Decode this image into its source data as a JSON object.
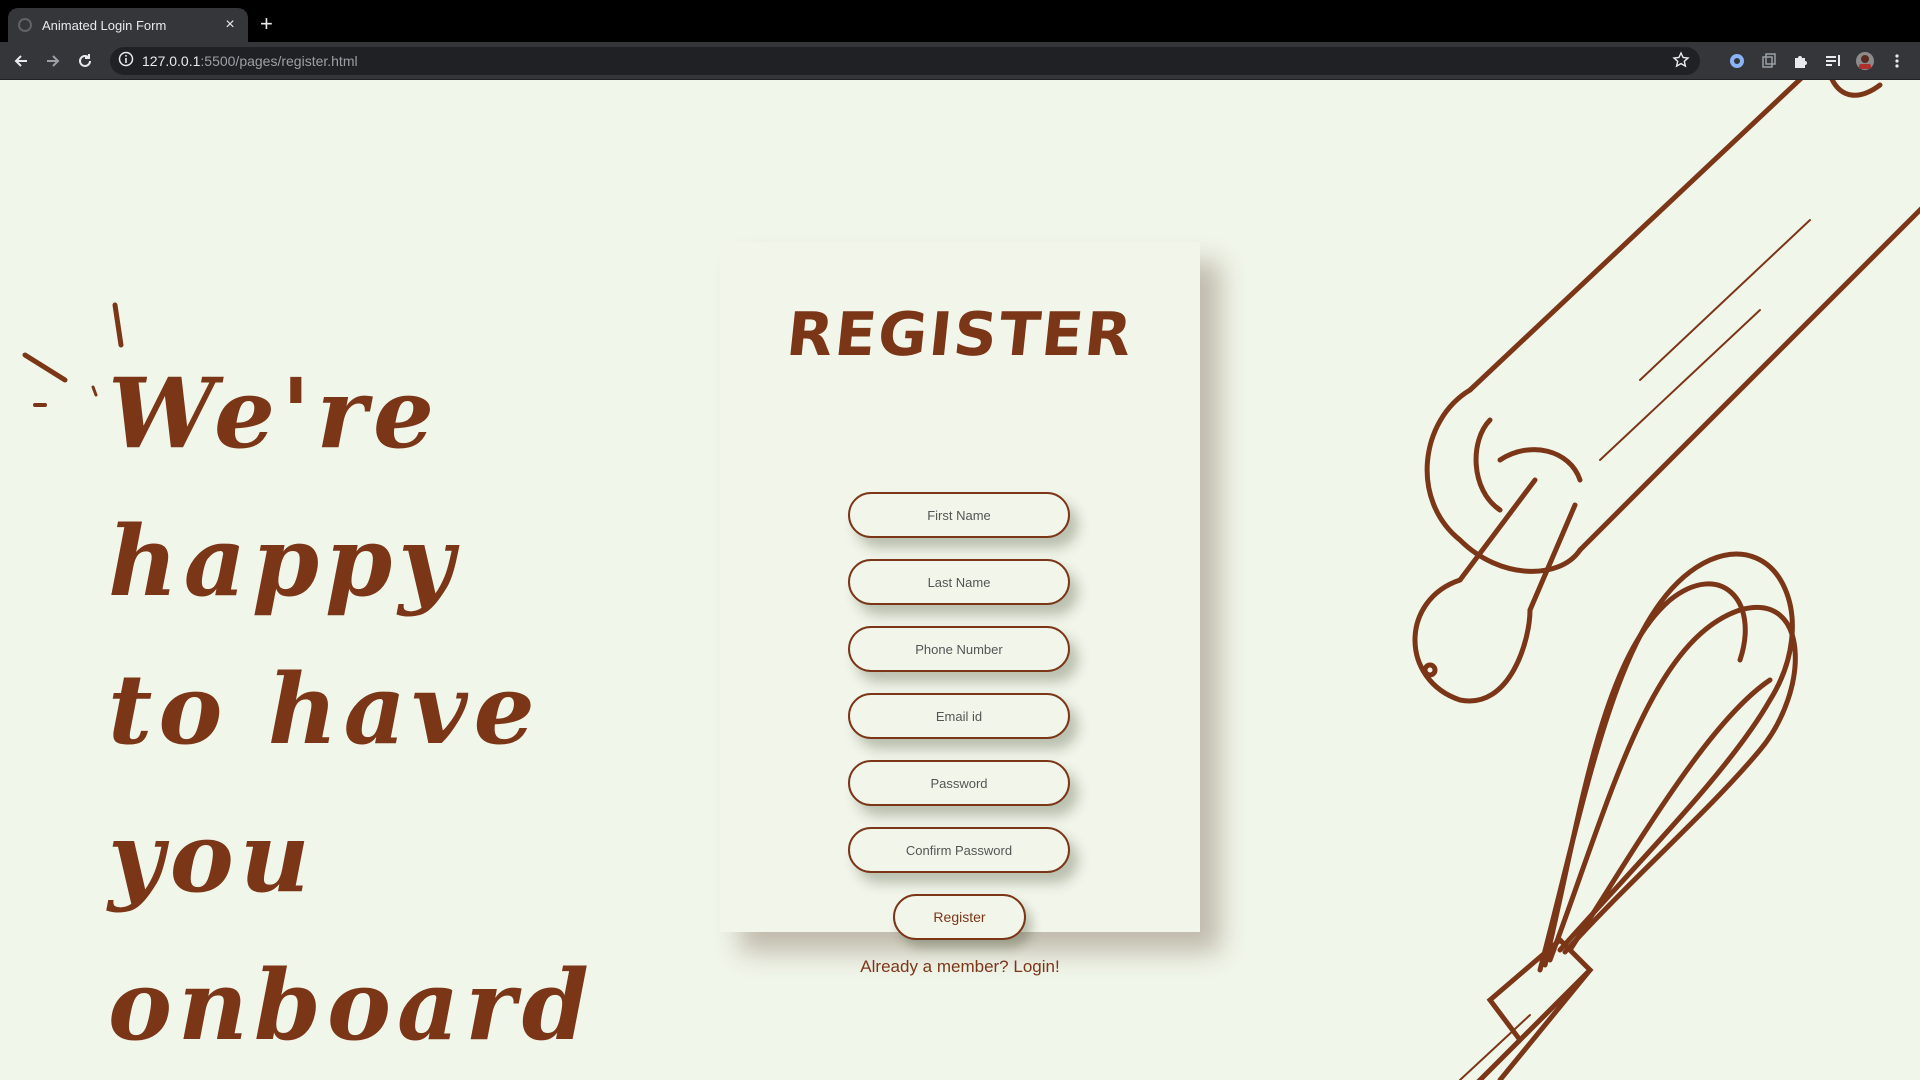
{
  "browser": {
    "tab_title": "Animated Login Form",
    "tab_close": "×",
    "new_tab": "+",
    "url_host": "127.0.0.1",
    "url_path": ":5500/pages/register.html"
  },
  "page": {
    "headline": [
      "We're",
      "happy",
      "to have",
      "you",
      "onboard"
    ],
    "form": {
      "title": "REGISTER",
      "fields": {
        "first_name": "First Name",
        "last_name": "Last Name",
        "phone": "Phone Number",
        "email": "Email id",
        "password": "Password",
        "confirm_password": "Confirm Password"
      },
      "submit": "Register",
      "login_link": "Already a member? Login!"
    },
    "illustrations": [
      "rolling-pin",
      "whisk"
    ]
  },
  "colors": {
    "brand": "#7b3618",
    "page_bg": "#f1f6ea",
    "chrome_bg": "#35363a"
  }
}
